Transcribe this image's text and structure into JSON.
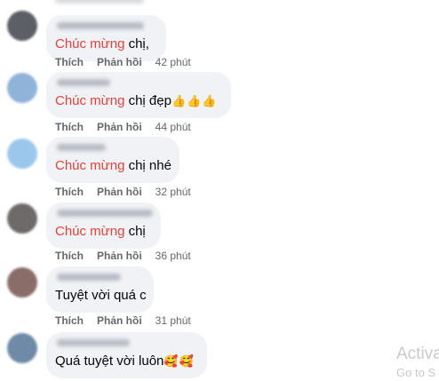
{
  "comments": [
    {
      "avatar_color": "#5c5f66",
      "text_highlight": "Chúc mừng",
      "text_rest": " chị,",
      "emoji": "",
      "like": "Thích",
      "reply": "Phản hồi",
      "time": "42 phút"
    },
    {
      "avatar_color": "#8fb3d9",
      "text_highlight": "Chúc mừng",
      "text_rest": " chị đẹp",
      "emoji": "👍👍👍",
      "like": "Thích",
      "reply": "Phản hồi",
      "time": "44 phút"
    },
    {
      "avatar_color": "#9cc7ec",
      "text_highlight": "Chúc mừng",
      "text_rest": " chị nhé",
      "emoji": "",
      "like": "Thích",
      "reply": "Phản hồi",
      "time": "32 phút"
    },
    {
      "avatar_color": "#6e6a6a",
      "text_highlight": "Chúc mừng",
      "text_rest": " chị",
      "emoji": "",
      "like": "Thích",
      "reply": "Phản hồi",
      "time": "36 phút"
    },
    {
      "avatar_color": "#8a6d68",
      "text_highlight": "",
      "text_rest": "Tuyệt vời quá c",
      "emoji": "",
      "like": "Thích",
      "reply": "Phản hồi",
      "time": "31 phút"
    },
    {
      "avatar_color": "#6f8aa6",
      "text_highlight": "",
      "text_rest": "Quá tuyệt vời luôn",
      "emoji": "🥰🥰",
      "like": "",
      "reply": "",
      "time": ""
    }
  ],
  "watermark": {
    "title": "Activa",
    "subtitle": "Go to S"
  }
}
